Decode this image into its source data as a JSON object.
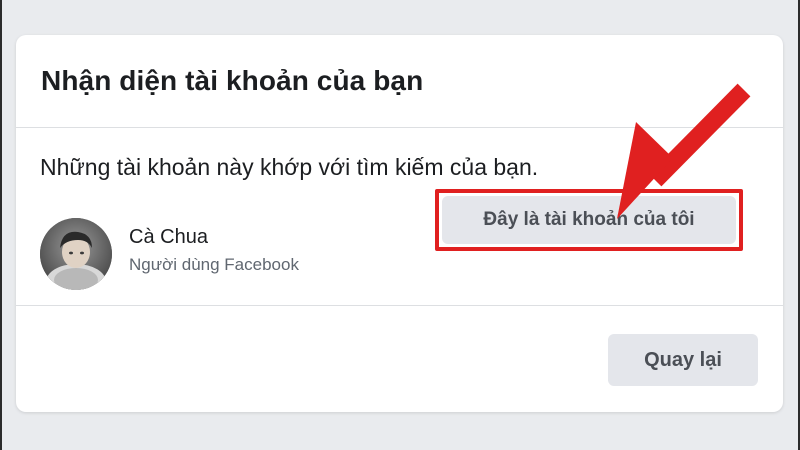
{
  "dialog": {
    "title": "Nhận diện tài khoản của bạn",
    "message": "Những tài khoản này khớp với tìm kiếm của bạn.",
    "account": {
      "name": "Cà Chua",
      "subtitle": "Người dùng Facebook",
      "confirm_label": "Đây là tài khoản của tôi"
    },
    "back_label": "Quay lại"
  },
  "colors": {
    "background": "#e9ebee",
    "card": "#ffffff",
    "button": "#e4e6eb",
    "button_text": "#4b4f56",
    "annotation": "#e02020"
  },
  "icons": {
    "avatar": "user-avatar-photo",
    "annotation_arrow": "red-arrow-icon"
  }
}
